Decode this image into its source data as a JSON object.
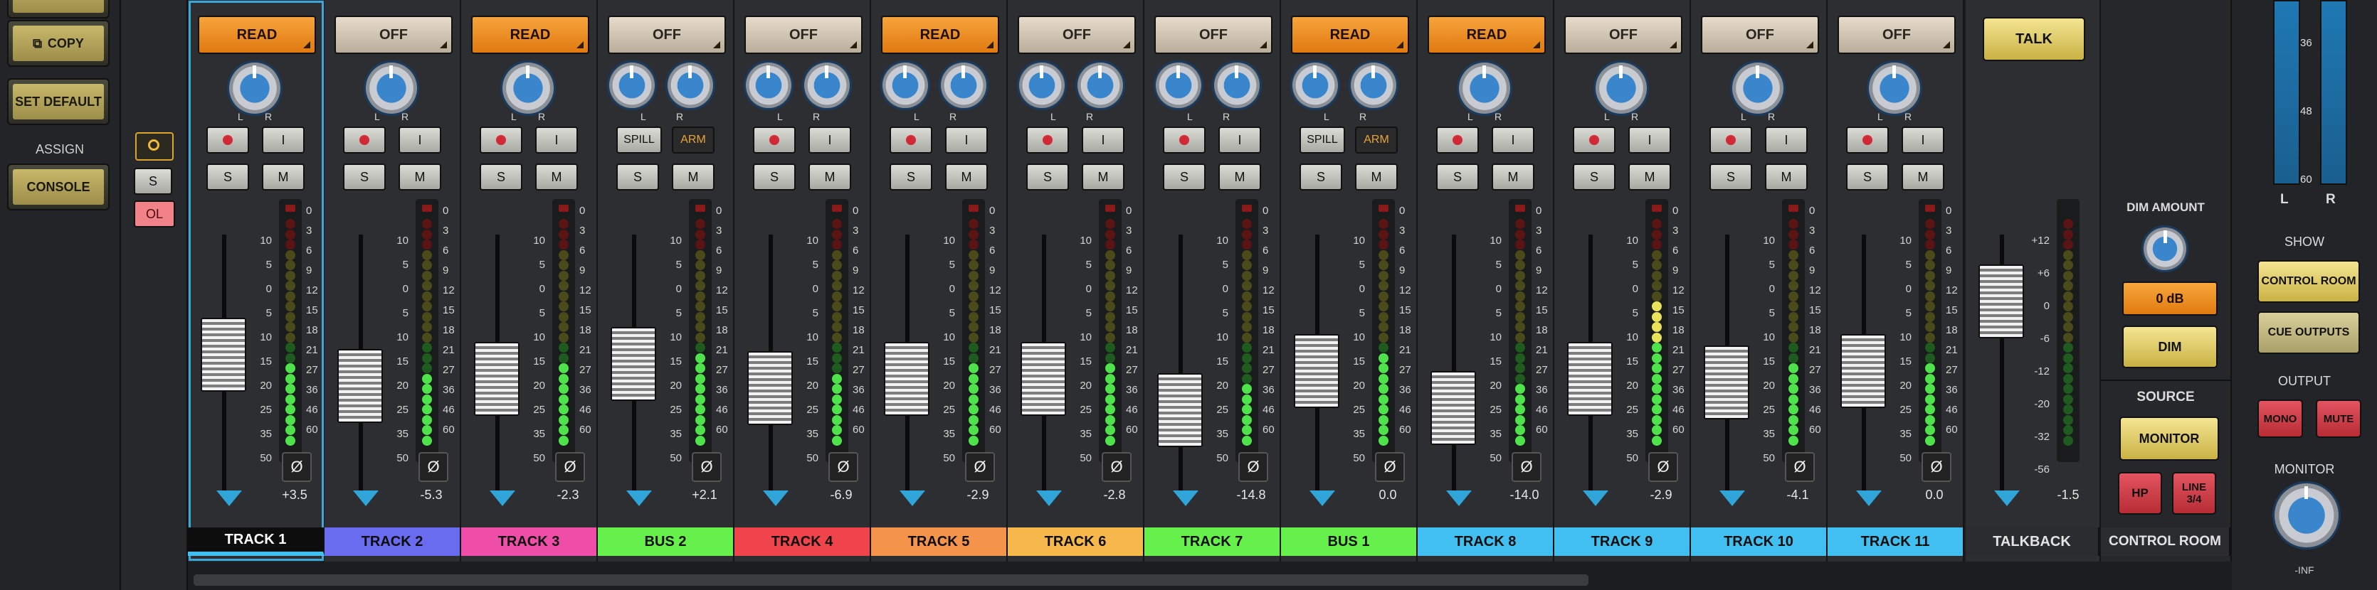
{
  "left": {
    "copy": "COPY",
    "set_default": "SET DEFAULT",
    "assign": "ASSIGN",
    "console": "CONSOLE"
  },
  "mid": {
    "solo": "S",
    "ol": "OL"
  },
  "strips": [
    {
      "auto": "READ",
      "knobs": 1,
      "spill": false,
      "vol": "+3.5",
      "name": "TRACK 1",
      "color": "#40bff0",
      "selected": true,
      "fader": 0.45
    },
    {
      "auto": "OFF",
      "knobs": 1,
      "spill": false,
      "vol": "-5.3",
      "name": "TRACK 2",
      "color": "#6a6cf0",
      "fader": 0.62
    },
    {
      "auto": "READ",
      "knobs": 1,
      "spill": false,
      "vol": "-2.3",
      "name": "TRACK 3",
      "color": "#ee4ea8",
      "fader": 0.58
    },
    {
      "auto": "OFF",
      "knobs": 2,
      "spill": true,
      "vol": "+2.1",
      "name": "BUS 2",
      "color": "#66f04c",
      "fader": 0.5
    },
    {
      "auto": "OFF",
      "knobs": 2,
      "spill": false,
      "vol": "-6.9",
      "name": "TRACK 4",
      "color": "#f0444c",
      "fader": 0.63
    },
    {
      "auto": "READ",
      "knobs": 2,
      "spill": false,
      "vol": "-2.9",
      "name": "TRACK 5",
      "color": "#f4934a",
      "fader": 0.58
    },
    {
      "auto": "OFF",
      "knobs": 2,
      "spill": false,
      "vol": "-2.8",
      "name": "TRACK 6",
      "color": "#f6b84a",
      "fader": 0.58
    },
    {
      "auto": "OFF",
      "knobs": 2,
      "spill": false,
      "vol": "-14.8",
      "name": "TRACK 7",
      "color": "#66f04c",
      "fader": 0.75
    },
    {
      "auto": "READ",
      "knobs": 2,
      "spill": true,
      "vol": "0.0",
      "name": "BUS 1",
      "color": "#66f04c",
      "fader": 0.54
    },
    {
      "auto": "READ",
      "knobs": 1,
      "spill": false,
      "vol": "-14.0",
      "name": "TRACK 8",
      "color": "#40bff0",
      "fader": 0.74
    },
    {
      "auto": "OFF",
      "knobs": 1,
      "spill": false,
      "vol": "-2.9",
      "name": "TRACK 9",
      "color": "#40bff0",
      "fader": 0.58
    },
    {
      "auto": "OFF",
      "knobs": 1,
      "spill": false,
      "vol": "-4.1",
      "name": "TRACK 10",
      "color": "#40bff0",
      "fader": 0.6
    },
    {
      "auto": "OFF",
      "knobs": 1,
      "spill": false,
      "vol": "0.0",
      "name": "TRACK 11",
      "color": "#40bff0",
      "fader": 0.54
    }
  ],
  "strip_buttons": {
    "solo": "S",
    "mute": "M",
    "input": "I",
    "spill": "SPILL",
    "arm": "ARM",
    "phase": "Ø",
    "left": "L",
    "right": "R"
  },
  "fader_scale": [
    "10",
    "5",
    "0",
    "5",
    "10",
    "15",
    "20",
    "25",
    "35",
    "50"
  ],
  "meter_scale": [
    "0",
    "3",
    "6",
    "9",
    "12",
    "15",
    "18",
    "21",
    "27",
    "36",
    "46",
    "60"
  ],
  "talkback": {
    "button": "TALK",
    "vol": "-1.5",
    "name": "TALKBACK",
    "scale": [
      "+12",
      "+6",
      "0",
      "-6",
      "-12",
      "-20",
      "-32",
      "-56"
    ]
  },
  "control_room": {
    "dim_amount": "DIM AMOUNT",
    "dim_value": "0 dB",
    "dim": "DIM",
    "source": "SOURCE",
    "monitor": "MONITOR",
    "hp": "HP",
    "line": "LINE 3/4",
    "name": "CONTROL ROOM"
  },
  "output": {
    "meter_scale": [
      "36",
      "48",
      "60"
    ],
    "l": "L",
    "r": "R",
    "show": "SHOW",
    "control_room_btn": "CONTROL ROOM",
    "cue_outputs": "CUE OUTPUTS",
    "output": "OUTPUT",
    "mono": "MONO",
    "mute": "MUTE",
    "monitor": "MONITOR",
    "inf": "-INF"
  },
  "colors": {
    "accent": "#3aa7d8",
    "read": "#f08a1c",
    "yellow_btn": "#d9c463",
    "red_btn": "#d7434d"
  }
}
